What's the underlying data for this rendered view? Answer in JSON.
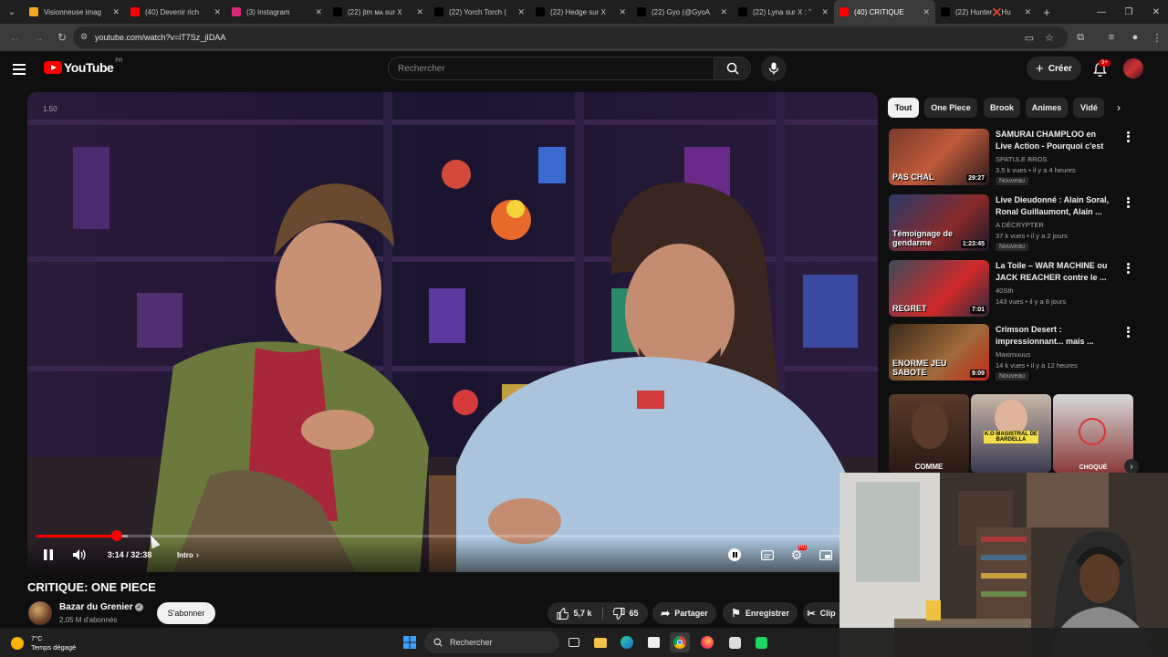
{
  "browser": {
    "tabs": [
      {
        "title": "Visionneuse imag",
        "favicon_color": "#f5a623",
        "active": false
      },
      {
        "title": "(40) Devenir rich",
        "favicon_color": "#ff0000",
        "active": false
      },
      {
        "title": "(3) Instagram",
        "favicon_color": "#d62976",
        "active": false
      },
      {
        "title": "(22) jtm ᴍᴀ sur X",
        "favicon_color": "#000000",
        "active": false
      },
      {
        "title": "(22) Yorch Torch (",
        "favicon_color": "#000000",
        "active": false
      },
      {
        "title": "(22) Hedge sur X",
        "favicon_color": "#000000",
        "active": false
      },
      {
        "title": "(22) Gyo (@GyoA",
        "favicon_color": "#000000",
        "active": false
      },
      {
        "title": "(22) Lyna sur X : \"",
        "favicon_color": "#000000",
        "active": false
      },
      {
        "title": "(40) CRITIQUE",
        "favicon_color": "#ff0000",
        "active": true
      },
      {
        "title": "(22) Hunter❌Hu",
        "favicon_color": "#000000",
        "active": false
      }
    ],
    "url": "youtube.com/watch?v=iT7Sz_jIDAA"
  },
  "youtube": {
    "logo_text": "YouTube",
    "country_code": "FR",
    "search_placeholder": "Rechercher",
    "create_label": "Créer",
    "notifications_badge": "9+"
  },
  "player": {
    "corner_label": "1.50",
    "time_current": "3:14",
    "time_total": "32:38",
    "time_label": "3:14 / 32:38",
    "chapter": "Intro",
    "progress_fraction": 0.099,
    "buffered_fraction": 0.113
  },
  "video": {
    "title": "CRITIQUE: ONE PIECE",
    "channel_name": "Bazar du Grenier",
    "subscribers": "2,05 M d'abonnés",
    "subscribe_label": "S'abonner",
    "likes": "5,7 k",
    "dislikes": "65",
    "share_label": "Partager",
    "save_label": "Enregistrer",
    "clip_label": "Clip"
  },
  "sidebar": {
    "chips": [
      "Tout",
      "One Piece",
      "Brook",
      "Animes",
      "Vidé"
    ],
    "recommendations": [
      {
        "title": "SAMURAI CHAMPLOO en Live Action - Pourquoi c'est une ...",
        "channel": "SPATULE BROS",
        "meta": "3,5 k vues • il y a 4 heures",
        "badge": "Nouveau",
        "duration": "29:27",
        "thumb_text": "PAS CHAL"
      },
      {
        "title": "Live Dieudonné : Alain Soral, Ronal Guillaumont, Alain ...",
        "channel": "A DÉCRYPTER",
        "meta": "37 k vues • il y a 2 jours",
        "badge": "Nouveau",
        "duration": "1:23:45",
        "thumb_text": "Témoignage de gendarme"
      },
      {
        "title": "La Toile – WAR MACHINE ou JACK REACHER contre le ...",
        "channel": "40Sth",
        "meta": "143 vues • il y a 8 jours",
        "badge": "",
        "duration": "7:01",
        "thumb_text": "REGRET"
      },
      {
        "title": "Crimson Desert : impressionnant... mais ...",
        "channel": "Maximuuus",
        "meta": "14 k vues • il y a 12 heures",
        "badge": "Nouveau",
        "duration": "9:09",
        "thumb_text": "ENORME JEU SABOTE"
      }
    ],
    "shorts": [
      {
        "caption": "COMME"
      },
      {
        "caption": "K.O MAGISTRAL DE BARDELLA"
      },
      {
        "caption": "CHOQUÉ"
      }
    ]
  },
  "taskbar": {
    "temperature": "7°C",
    "weather": "Temps dégagé",
    "search_label": "Rechercher"
  }
}
